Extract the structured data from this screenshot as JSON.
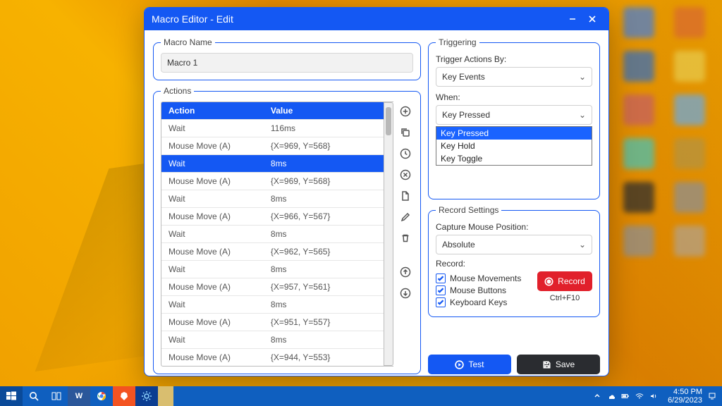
{
  "window": {
    "title": "Macro Editor - Edit"
  },
  "macroName": {
    "legend": "Macro Name",
    "value": "Macro 1"
  },
  "actions": {
    "legend": "Actions",
    "columns": {
      "action": "Action",
      "value": "Value"
    },
    "selected_index": 2,
    "rows": [
      {
        "action": "Wait",
        "value": "116ms"
      },
      {
        "action": "Mouse Move (A)",
        "value": "{X=969, Y=568}"
      },
      {
        "action": "Wait",
        "value": "8ms"
      },
      {
        "action": "Mouse Move (A)",
        "value": "{X=969, Y=568}"
      },
      {
        "action": "Wait",
        "value": "8ms"
      },
      {
        "action": "Mouse Move (A)",
        "value": "{X=966, Y=567}"
      },
      {
        "action": "Wait",
        "value": "8ms"
      },
      {
        "action": "Mouse Move (A)",
        "value": "{X=962, Y=565}"
      },
      {
        "action": "Wait",
        "value": "8ms"
      },
      {
        "action": "Mouse Move (A)",
        "value": "{X=957, Y=561}"
      },
      {
        "action": "Wait",
        "value": "8ms"
      },
      {
        "action": "Mouse Move (A)",
        "value": "{X=951, Y=557}"
      },
      {
        "action": "Wait",
        "value": "8ms"
      },
      {
        "action": "Mouse Move (A)",
        "value": "{X=944, Y=553}"
      }
    ]
  },
  "triggering": {
    "legend": "Triggering",
    "trigger_by_label": "Trigger Actions By:",
    "trigger_by_value": "Key Events",
    "when_label": "When:",
    "when_value": "Key Pressed",
    "when_options": [
      "Key Pressed",
      "Key Hold",
      "Key Toggle"
    ],
    "when_selected_index": 0
  },
  "record": {
    "legend": "Record Settings",
    "capture_label": "Capture Mouse Position:",
    "capture_value": "Absolute",
    "record_label": "Record:",
    "checks": {
      "mouse_movements": {
        "label": "Mouse Movements",
        "checked": true
      },
      "mouse_buttons": {
        "label": "Mouse Buttons",
        "checked": true
      },
      "keyboard_keys": {
        "label": "Keyboard Keys",
        "checked": true
      }
    },
    "record_button": "Record",
    "record_shortcut": "Ctrl+F10"
  },
  "buttons": {
    "test": "Test",
    "save": "Save"
  },
  "taskbar": {
    "time": "4:50 PM",
    "date": "6/29/2023"
  }
}
